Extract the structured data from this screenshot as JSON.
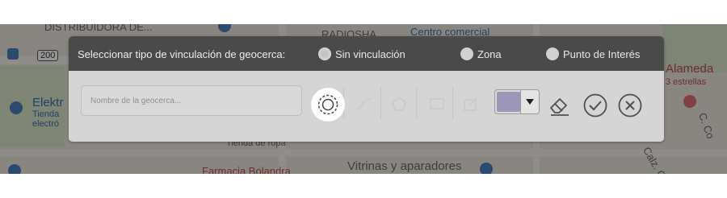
{
  "map": {
    "labels": {
      "distribuidora": "DISTRIBUIDORA DE...",
      "radioshack": "RADIOSHA",
      "centro_comercial": "Centro comercial",
      "alameda": "Alameda",
      "estrellas": "3 estrellas",
      "elektra": "Elektr",
      "tienda": "Tienda",
      "electro": "electró",
      "tienda_ropa": "Tienda de ropa",
      "farmacia": "Farmacia Bolandra",
      "vitrinas": "Vitrinas y aparadores",
      "calz": "Calz. C",
      "calle": "C. Co",
      "route": "200"
    }
  },
  "panel": {
    "header": {
      "title": "Seleccionar tipo de vinculación de geocerca:",
      "options": [
        {
          "label": "Sin vinculación",
          "selected": true
        },
        {
          "label": "Zona",
          "selected": false
        },
        {
          "label": "Punto de Interés",
          "selected": false
        }
      ]
    },
    "name_input": {
      "placeholder": "Nombre de la geocerca...",
      "value": ""
    },
    "tools": [
      "circle-tool",
      "polyline-tool",
      "polygon-tool",
      "rectangle-tool",
      "edit-tool"
    ],
    "color": {
      "selected": "#9c97b8"
    },
    "actions": [
      "eraser",
      "confirm",
      "cancel"
    ]
  },
  "colors": {
    "header_bg": "#4a4a4a",
    "body_bg": "#d6d6d6",
    "icon": "#4f4f4f"
  }
}
